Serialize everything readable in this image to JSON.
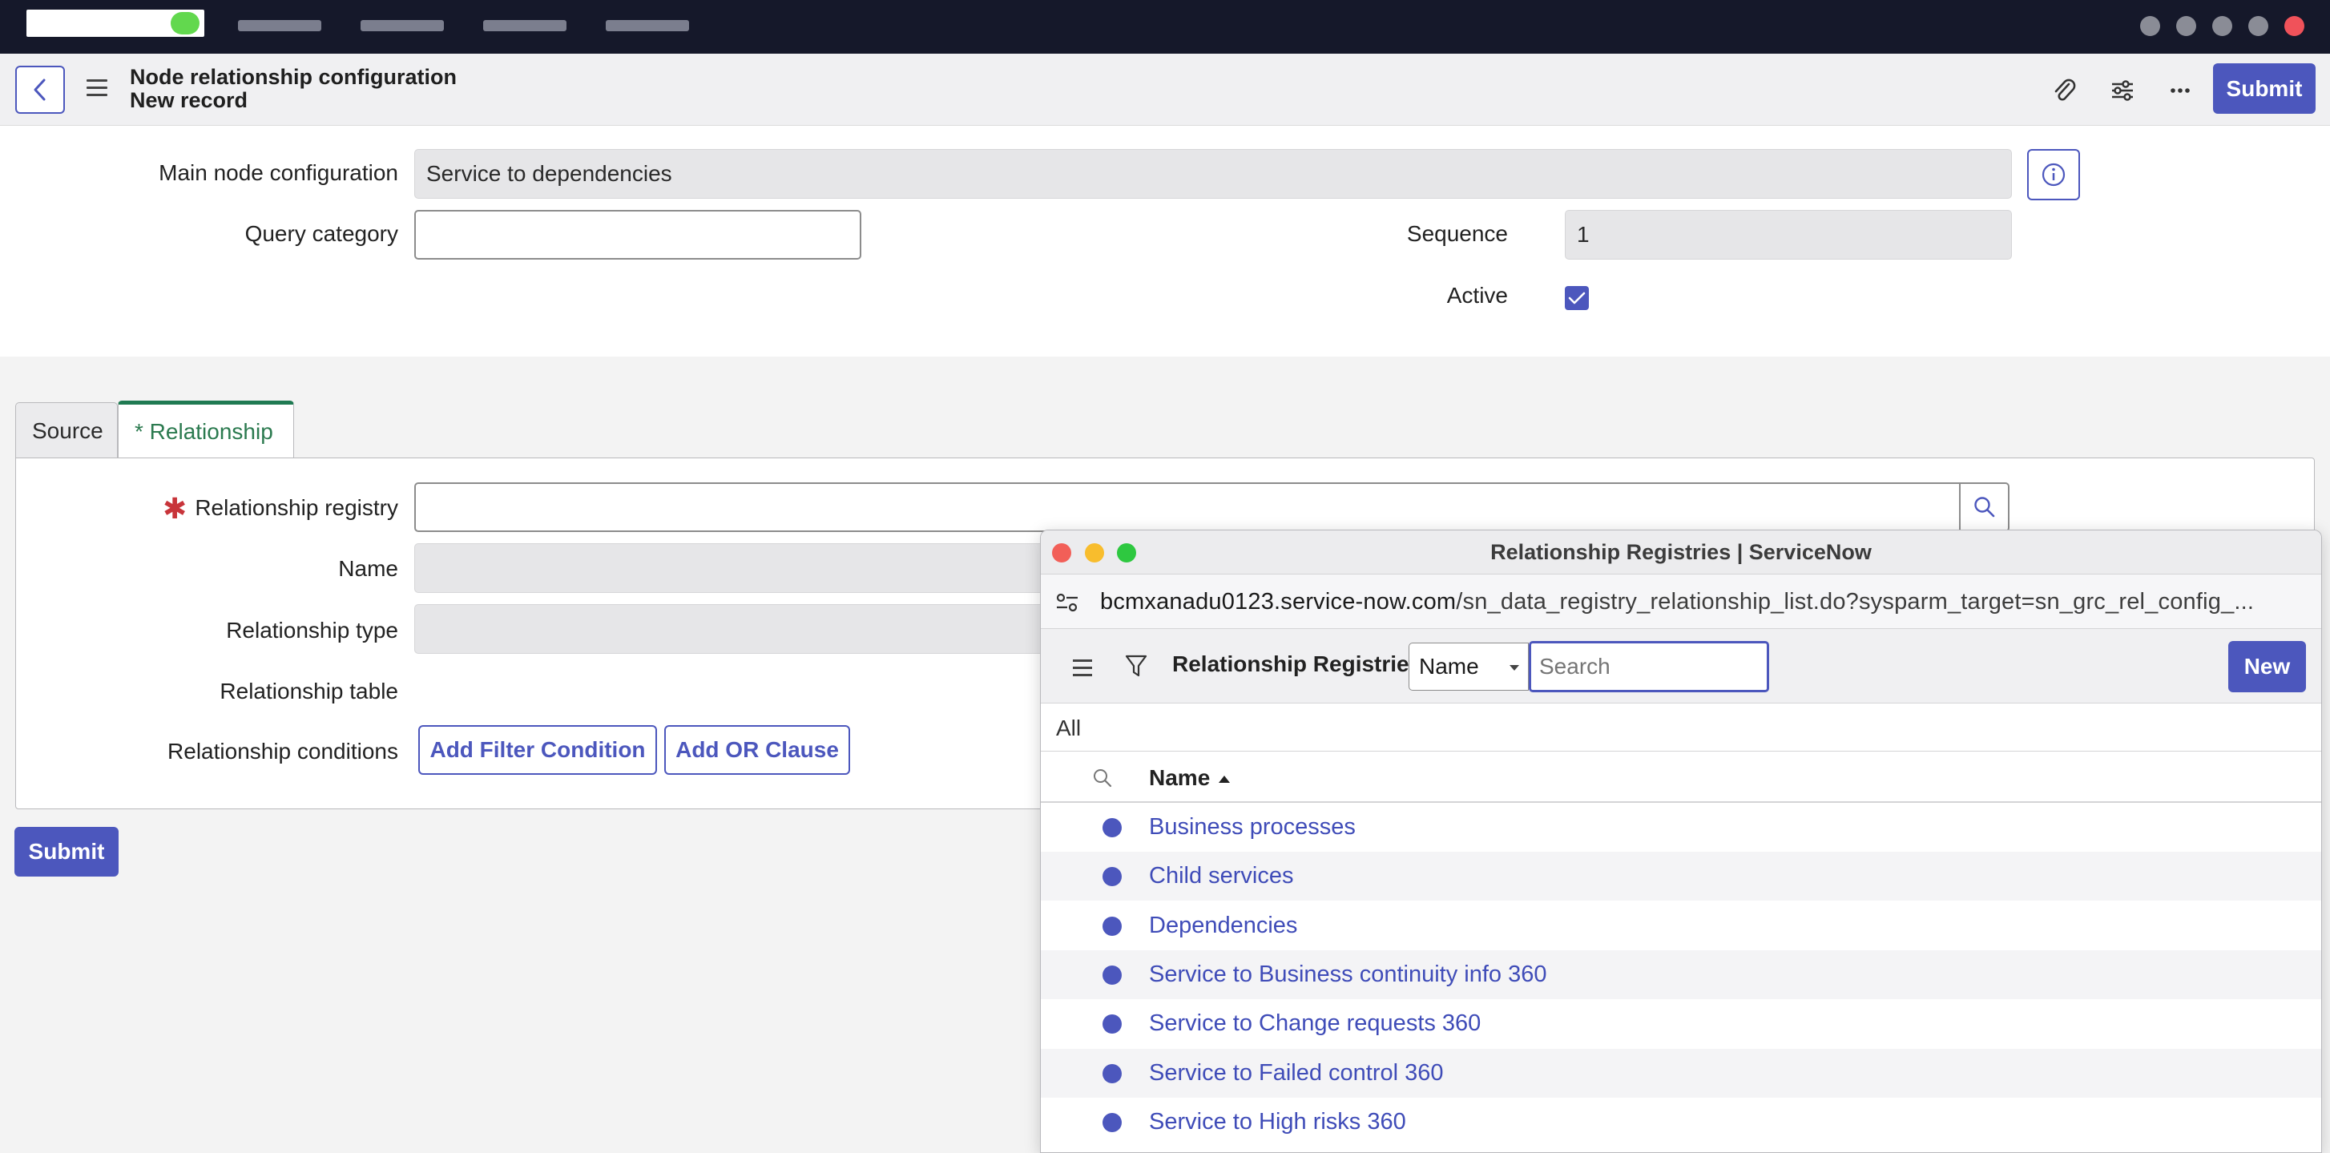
{
  "topbar": {
    "nav_items": [
      "",
      "",
      "",
      ""
    ]
  },
  "header": {
    "title": "Node relationship configuration",
    "subtitle": "New record",
    "submit_label": "Submit"
  },
  "form": {
    "main_node_label": "Main node configuration",
    "main_node_value": "Service to dependencies",
    "query_category_label": "Query category",
    "query_category_value": "",
    "sequence_label": "Sequence",
    "sequence_value": "1",
    "active_label": "Active",
    "active_checked": true
  },
  "tabs": [
    {
      "label": "Source"
    },
    {
      "label": "* Relationship"
    }
  ],
  "relationship": {
    "registry_label": "Relationship registry",
    "registry_value": "",
    "name_label": "Name",
    "type_label": "Relationship type",
    "table_label": "Relationship table",
    "conditions_label": "Relationship conditions",
    "add_filter_label": "Add Filter Condition",
    "add_or_label": "Add OR Clause"
  },
  "bottom_submit_label": "Submit",
  "popup": {
    "window_title": "Relationship Registries | ServiceNow",
    "url_host": "bcmxanadu0123.service-now.com",
    "url_path": "/sn_data_registry_relationship_list.do?sysparm_target=sn_grc_rel_config_...",
    "list_title": "Relationship Registries",
    "search_field": "Name",
    "search_placeholder": "Search",
    "new_label": "New",
    "breadcrumb": "All",
    "column_name": "Name",
    "rows": [
      "Business processes",
      "Child services",
      "Dependencies",
      "Service to Business continuity info 360",
      "Service to Change requests 360",
      "Service to Failed control 360",
      "Service to High risks 360"
    ]
  },
  "colors": {
    "accent": "#4c57bd",
    "topbar": "#15182a",
    "active_tab": "#1f7a52",
    "required": "#c8343a"
  }
}
